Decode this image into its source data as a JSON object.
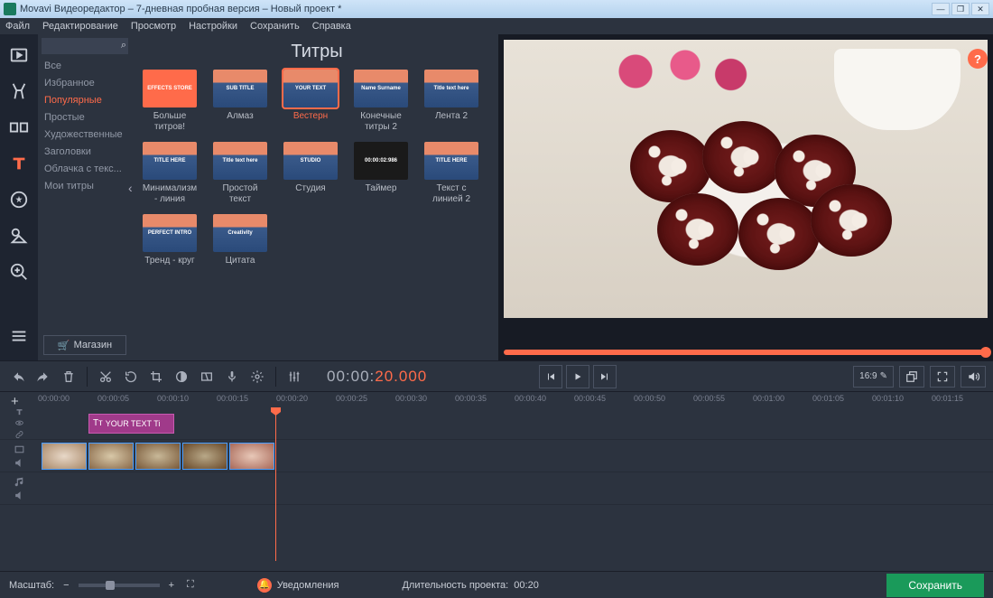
{
  "window": {
    "title": "Movavi Видеоредактор – 7-дневная пробная версия – Новый проект *"
  },
  "menu": [
    "Файл",
    "Редактирование",
    "Просмотр",
    "Настройки",
    "Сохранить",
    "Справка"
  ],
  "categories": {
    "title": "Титры",
    "items": [
      "Все",
      "Избранное",
      "Популярные",
      "Простые",
      "Художественные",
      "Заголовки",
      "Облачка с текс...",
      "Мои титры"
    ],
    "activeIndex": 2,
    "store": "Магазин"
  },
  "sidetools": [
    "import",
    "filters",
    "transitions",
    "titles",
    "stickers",
    "callouts",
    "zoom",
    "more"
  ],
  "sidetoolActive": 3,
  "thumbs": [
    {
      "label": "Больше титров!",
      "text": "EFFECTS STORE",
      "store": true
    },
    {
      "label": "Алмаз",
      "text": "SUB TITLE"
    },
    {
      "label": "Вестерн",
      "text": "YOUR TEXT",
      "selected": true
    },
    {
      "label": "Конечные титры 2",
      "text": "Name Surname"
    },
    {
      "label": "Лента 2",
      "text": "Title text here"
    },
    {
      "label": "Минимализм - линия",
      "text": "TITLE HERE"
    },
    {
      "label": "Простой текст",
      "text": "Title text here"
    },
    {
      "label": "Студия",
      "text": "STUDIO"
    },
    {
      "label": "Таймер",
      "text": "00:00:02:986",
      "dark": true
    },
    {
      "label": "Текст с линией 2",
      "text": "TITLE HERE"
    },
    {
      "label": "Тренд - круг",
      "text": "PERFECT INTRO"
    },
    {
      "label": "Цитата",
      "text": "Creativity"
    }
  ],
  "timecode": {
    "gray": "00:00:",
    "orange": "20.000"
  },
  "aspect": "16:9",
  "ruler": [
    "00:00:00",
    "00:00:05",
    "00:00:10",
    "00:00:15",
    "00:00:20",
    "00:00:25",
    "00:00:30",
    "00:00:35",
    "00:00:40",
    "00:00:45",
    "00:00:50",
    "00:00:55",
    "00:01:00",
    "00:01:05",
    "00:01:10",
    "00:01:15"
  ],
  "titleclip": "YOUR TEXT Ti",
  "status": {
    "zoom": "Масштаб:",
    "notif": "Уведомления",
    "duration_label": "Длительность проекта:",
    "duration": "00:20",
    "save": "Сохранить"
  },
  "help": "?"
}
